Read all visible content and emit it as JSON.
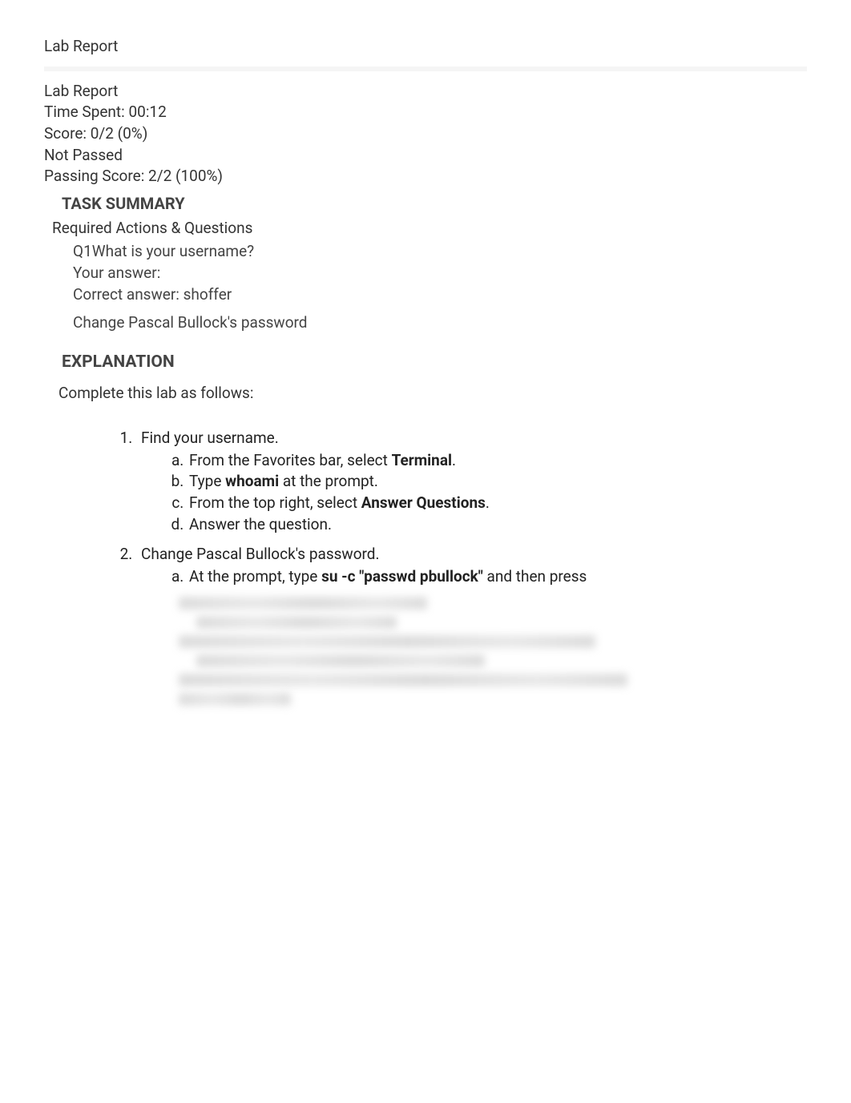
{
  "page": {
    "title": "Lab Report"
  },
  "meta": {
    "heading": "Lab Report",
    "time_label": "Time Spent: ",
    "time_value": "00:12",
    "score_label": "Score: ",
    "score_value": "0/2 (0%)",
    "status": " Not Passed",
    "passing_label": "Passing Score: ",
    "passing_value": "2/2 (100%)"
  },
  "task_summary": {
    "heading": "TASK SUMMARY",
    "required_heading": "Required Actions & Questions",
    "q1_prefix": "Q1",
    "q1_text": "What is your username?",
    "your_answer_label": "Your answer:",
    "your_answer_value": "",
    "correct_answer_label": "Correct answer: ",
    "correct_answer_value": "shoffer",
    "action2": "Change Pascal Bullock's password"
  },
  "explanation": {
    "heading": "EXPLANATION",
    "intro": "Complete this lab as follows:",
    "steps": [
      {
        "text": "Find your username.",
        "sub": [
          {
            "pre": "From the Favorites bar, select ",
            "bold": "Terminal",
            "post": "."
          },
          {
            "pre": "Type ",
            "bold": "whoami",
            "post": " at the prompt."
          },
          {
            "pre": "From the top right, select ",
            "bold": "Answer Questions",
            "post": "."
          },
          {
            "pre": "Answer the question.",
            "bold": "",
            "post": ""
          }
        ]
      },
      {
        "text": "Change Pascal Bullock's password.",
        "sub": [
          {
            "pre": "At the prompt, type ",
            "bold": "su -c \"passwd pbullock\"",
            "post": " and then press "
          }
        ]
      }
    ]
  }
}
